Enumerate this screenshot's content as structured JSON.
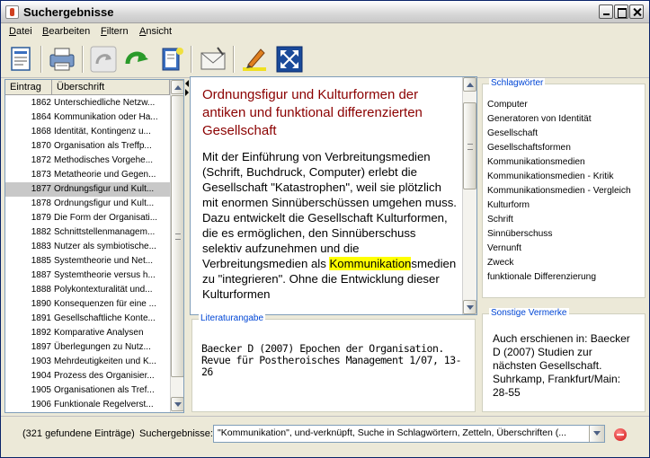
{
  "window": {
    "title": "Suchergebnisse"
  },
  "menu": [
    "Datei",
    "Bearbeiten",
    "Filtern",
    "Ansicht"
  ],
  "toolbar": {
    "icons": [
      "report-icon",
      "print-icon",
      "back-icon",
      "forward-icon",
      "bookmark-icon",
      "envelope-icon",
      "highlight-pen-icon",
      "fullscreen-icon"
    ]
  },
  "list": {
    "headers": [
      "Eintrag",
      "Überschrift"
    ],
    "selected_index": 6,
    "rows": [
      {
        "num": "1862",
        "text": "Unterschiedliche Netzw..."
      },
      {
        "num": "1864",
        "text": "Kommunikation oder Ha..."
      },
      {
        "num": "1868",
        "text": "Identität, Kontingenz u..."
      },
      {
        "num": "1870",
        "text": "Organisation als Treffp..."
      },
      {
        "num": "1872",
        "text": "Methodisches Vorgehe..."
      },
      {
        "num": "1873",
        "text": "Metatheorie und Gegen..."
      },
      {
        "num": "1877",
        "text": "Ordnungsfigur und Kult..."
      },
      {
        "num": "1878",
        "text": "Ordnungsfigur und Kult..."
      },
      {
        "num": "1879",
        "text": "Die Form der Organisati..."
      },
      {
        "num": "1882",
        "text": "Schnittstellenmanagem..."
      },
      {
        "num": "1883",
        "text": "Nutzer als symbiotische..."
      },
      {
        "num": "1885",
        "text": "Systemtheorie und Net..."
      },
      {
        "num": "1887",
        "text": "Systemtheorie versus h..."
      },
      {
        "num": "1888",
        "text": "Polykontexturalität und..."
      },
      {
        "num": "1890",
        "text": "Konsequenzen für eine ..."
      },
      {
        "num": "1891",
        "text": "Gesellschaftliche Konte..."
      },
      {
        "num": "1892",
        "text": "Komparative Analysen"
      },
      {
        "num": "1897",
        "text": "Überlegungen zu  Nutz..."
      },
      {
        "num": "1903",
        "text": "Mehrdeutigkeiten und K..."
      },
      {
        "num": "1904",
        "text": "Prozess des Organisier..."
      },
      {
        "num": "1905",
        "text": "Organisationen als Tref..."
      },
      {
        "num": "1906",
        "text": "Funktionale Regelverst..."
      }
    ]
  },
  "article": {
    "title": "Ordnungsfigur und Kulturformen der antiken und funktional differenzierten Gesellschaft",
    "body_before": "Mit der Einführung von Verbreitungsmedien (Schrift, Buchdruck, Computer) erlebt die Gesellschaft \"Katastrophen\", weil sie plötzlich mit enormen Sinnüberschüssen umgehen muss. Dazu entwickelt die Gesellschaft Kulturformen, die es ermöglichen, den Sinnüberschuss selektiv aufzunehmen und die Verbreitungsmedien als ",
    "body_highlight": "Kommunikation",
    "body_after": "smedien zu \"integrieren\". Ohne die Entwicklung dieser Kulturformen"
  },
  "literature": {
    "label": "Literaturangabe",
    "text": "Baecker D (2007) Epochen der Organisation. Revue für Postheroisches Management 1/07, 13-26"
  },
  "keywords": {
    "label": "Schlagwörter",
    "items": [
      "Computer",
      "Generatoren von Identität",
      "Gesellschaft",
      "Gesellschaftsformen",
      "Kommunikationsmedien",
      "Kommunikationsmedien - Kritik",
      "Kommunikationsmedien - Vergleich",
      "Kulturform",
      "Schrift",
      "Sinnüberschuss",
      "Vernunft",
      "Zweck",
      "funktionale Differenzierung"
    ]
  },
  "notes": {
    "label": "Sonstige Vermerke",
    "text": "Auch erschienen in: Baecker D (2007) Studien zur nächsten Gesellschaft. Suhrkamp, Frankfurt/Main: 28-55"
  },
  "status": {
    "count": "(321 gefundene Einträge)",
    "search_label": "Suchergebnisse:",
    "search_value": "\"Kommunikation\", und-verknüpft, Suche in Schlagwörtern, Zetteln, Überschriften (..."
  }
}
